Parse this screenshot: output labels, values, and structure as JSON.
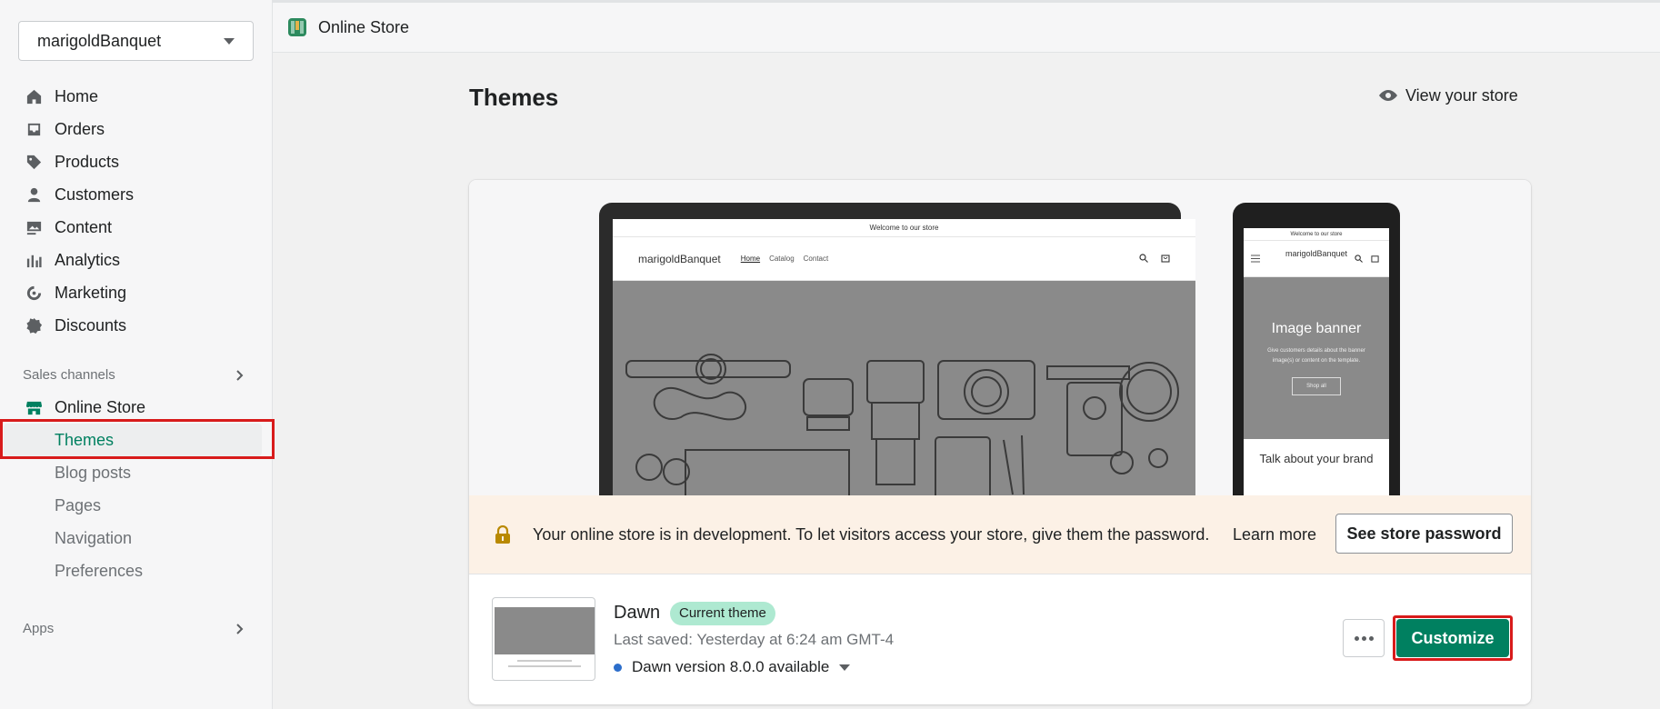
{
  "sidebar": {
    "store_name": "marigoldBanquet",
    "items": [
      {
        "label": "Home",
        "icon": "home-icon"
      },
      {
        "label": "Orders",
        "icon": "orders-icon"
      },
      {
        "label": "Products",
        "icon": "tag-icon"
      },
      {
        "label": "Customers",
        "icon": "person-icon"
      },
      {
        "label": "Content",
        "icon": "image-icon"
      },
      {
        "label": "Analytics",
        "icon": "bar-chart-icon"
      },
      {
        "label": "Marketing",
        "icon": "target-icon"
      },
      {
        "label": "Discounts",
        "icon": "discount-icon"
      }
    ],
    "sales_channels_label": "Sales channels",
    "online_store_label": "Online Store",
    "sub_items": [
      "Themes",
      "Blog posts",
      "Pages",
      "Navigation",
      "Preferences"
    ],
    "apps_label": "Apps"
  },
  "topbar": {
    "title": "Online Store"
  },
  "main": {
    "title": "Themes",
    "view_store": "View your store"
  },
  "preview": {
    "announcement": "Welcome to our store",
    "brand": "marigoldBanquet",
    "nav_links": [
      "Home",
      "Catalog",
      "Contact"
    ],
    "mobile_brand": "marigoldBanquet",
    "mobile_banner_title": "Image banner",
    "mobile_banner_text": "Give customers details about the banner image(s) or content on the template.",
    "mobile_banner_button": "Shop all",
    "mobile_talk": "Talk about your brand"
  },
  "dev_banner": {
    "text": "Your online store is in development. To let visitors access your store, give them the password.",
    "learn_more": "Learn more",
    "password_button": "See store password"
  },
  "theme": {
    "name": "Dawn",
    "badge": "Current theme",
    "last_saved": "Last saved: Yesterday at 6:24 am GMT-4",
    "version": "Dawn version 8.0.0 available",
    "customize": "Customize"
  },
  "colors": {
    "accent": "#008060",
    "badge_bg": "#aee9d1",
    "banner_bg": "#fcf1e6",
    "highlight": "#d81b1b"
  }
}
